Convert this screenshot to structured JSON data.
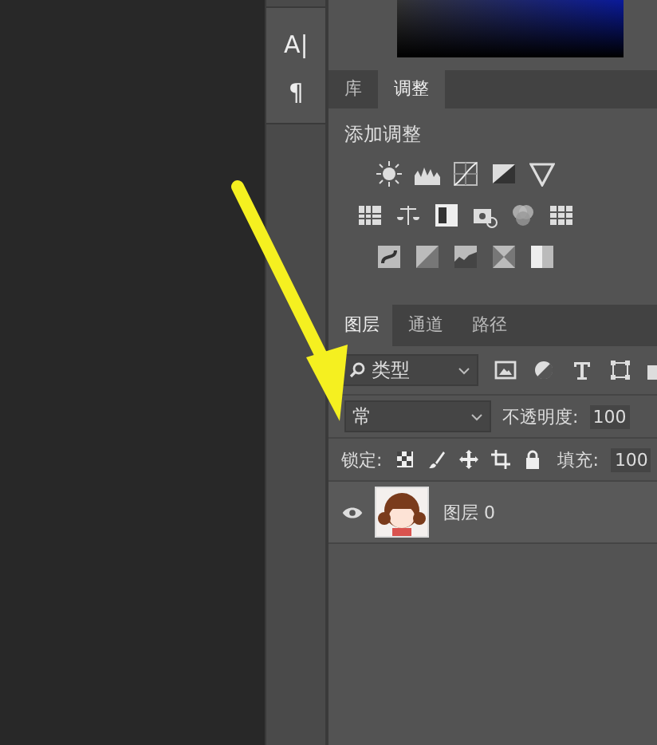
{
  "tool_strip": {
    "glyphs": [
      "A|",
      "¶"
    ]
  },
  "adjustments_panel": {
    "tabs": [
      {
        "label": "库",
        "selected": false
      },
      {
        "label": "调整",
        "selected": true
      }
    ],
    "heading": "添加调整"
  },
  "layers_panel": {
    "tabs": [
      {
        "label": "图层",
        "selected": true
      },
      {
        "label": "通道",
        "selected": false
      },
      {
        "label": "路径",
        "selected": false
      }
    ],
    "filter": {
      "value": "类型"
    },
    "blend_mode": {
      "value": "常"
    },
    "opacity": {
      "label": "不透明度:",
      "value": "100"
    },
    "lock": {
      "label": "锁定:"
    },
    "fill": {
      "label": "填充:",
      "value": "100"
    },
    "layers": [
      {
        "name": "图层 0",
        "visible": true
      }
    ]
  }
}
